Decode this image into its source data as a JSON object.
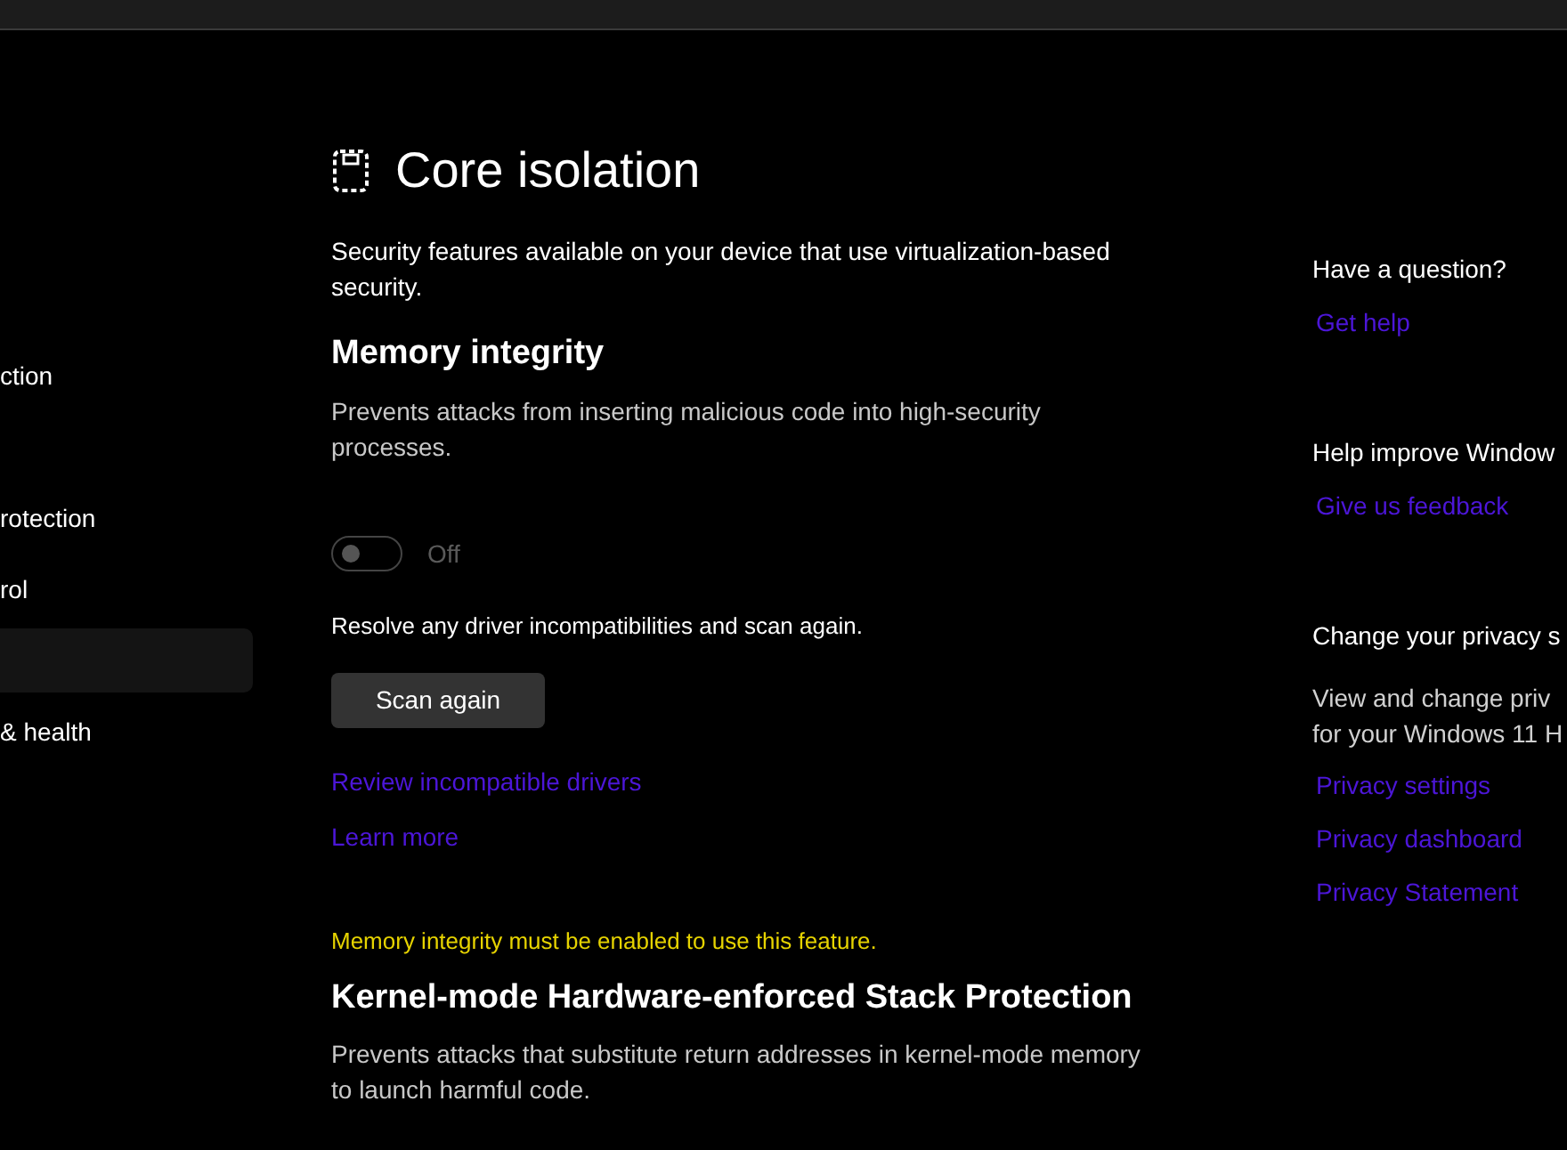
{
  "sidebar": {
    "items": [
      {
        "label": "ction",
        "selected": false
      },
      {
        "label": "rotection",
        "selected": false
      },
      {
        "label": "rol",
        "selected": false
      },
      {
        "selected": true
      },
      {
        "label": "& health",
        "selected": false
      }
    ]
  },
  "page": {
    "title": "Core isolation",
    "description": "Security features available on your device that use virtualization-based security."
  },
  "sections": [
    {
      "kind": "toggle",
      "title": "Memory integrity",
      "description": "Prevents attacks from inserting malicious code into high-security processes.",
      "toggle": {
        "on": false,
        "label": "Off"
      },
      "note": "Resolve any driver incompatibilities and scan again.",
      "button": "Scan again",
      "links": [
        "Review incompatible drivers",
        "Learn more"
      ],
      "warning": "Memory integrity must be enabled to use this feature."
    },
    {
      "kind": "plain",
      "title": "Kernel-mode Hardware-enforced Stack Protection",
      "description": "Prevents attacks that substitute return addresses in kernel-mode memory to launch harmful code."
    }
  ],
  "aside": [
    {
      "heading": "Have a question?",
      "links": [
        "Get help"
      ]
    },
    {
      "heading": "Help improve Window",
      "links": [
        "Give us feedback"
      ]
    },
    {
      "heading": "Change your privacy s",
      "text": [
        "View and change priv",
        "for your Windows 11 H"
      ],
      "links": [
        "Privacy settings",
        "Privacy dashboard",
        "Privacy Statement"
      ]
    }
  ]
}
